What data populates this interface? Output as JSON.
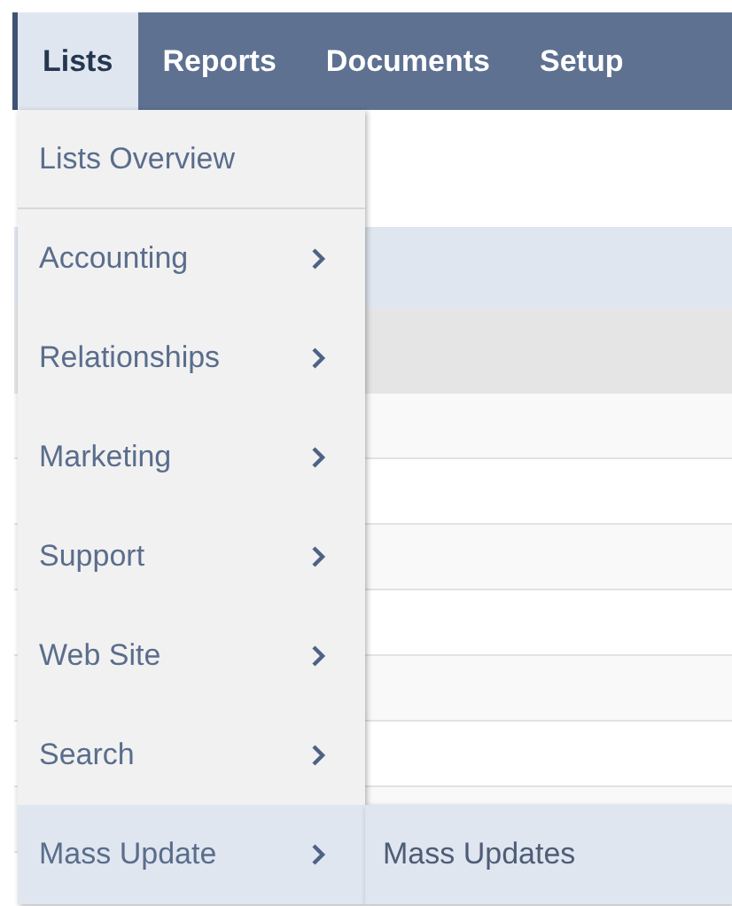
{
  "nav": {
    "tabs": [
      {
        "label": "Lists",
        "selected": true
      },
      {
        "label": "Reports",
        "selected": false
      },
      {
        "label": "Documents",
        "selected": false
      },
      {
        "label": "Setup",
        "selected": false
      }
    ]
  },
  "menu": {
    "items": [
      {
        "label": "Lists Overview",
        "kind": "link",
        "selected": false
      },
      {
        "label": "Accounting",
        "kind": "submenu",
        "selected": false
      },
      {
        "label": "Relationships",
        "kind": "submenu",
        "selected": false
      },
      {
        "label": "Marketing",
        "kind": "submenu",
        "selected": false
      },
      {
        "label": "Support",
        "kind": "submenu",
        "selected": false
      },
      {
        "label": "Web Site",
        "kind": "submenu",
        "selected": false
      },
      {
        "label": "Search",
        "kind": "submenu",
        "selected": false
      },
      {
        "label": "Mass Update",
        "kind": "submenu",
        "selected": true
      }
    ]
  },
  "submenu": {
    "items": [
      {
        "label": "Mass Updates"
      }
    ]
  }
}
